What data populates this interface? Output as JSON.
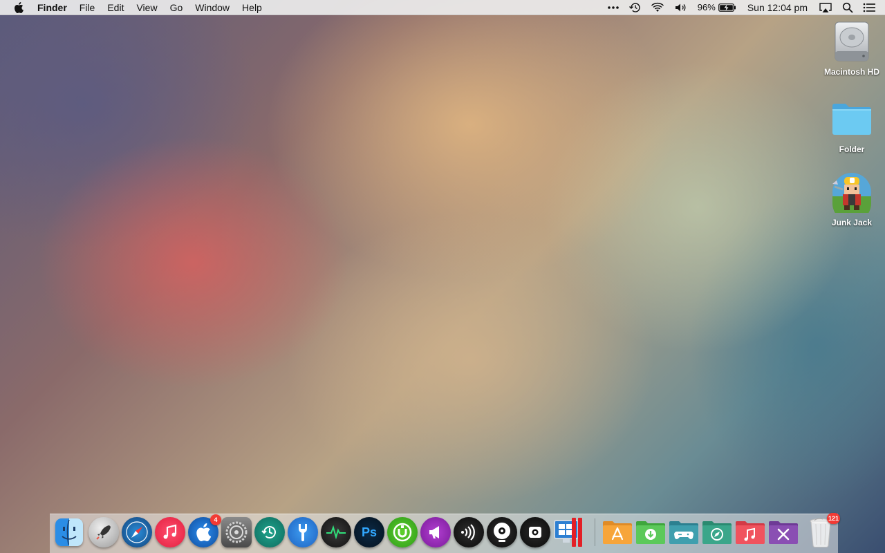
{
  "menubar": {
    "app_name": "Finder",
    "menus": [
      "File",
      "Edit",
      "View",
      "Go",
      "Window",
      "Help"
    ],
    "status": {
      "battery_percent": "96%",
      "clock": "Sun 12:04 pm"
    }
  },
  "desktop": {
    "icons": [
      {
        "label": "Macintosh HD"
      },
      {
        "label": "Folder"
      },
      {
        "label": "Junk Jack"
      }
    ]
  },
  "dock": {
    "apps": [
      {
        "name": "finder-icon"
      },
      {
        "name": "launchpad-icon"
      },
      {
        "name": "safari-icon"
      },
      {
        "name": "itunes-icon"
      },
      {
        "name": "app-store-icon",
        "badge": "4"
      },
      {
        "name": "system-preferences-icon"
      },
      {
        "name": "time-machine-icon"
      },
      {
        "name": "utility-tool-icon"
      },
      {
        "name": "activity-monitor-icon"
      },
      {
        "name": "photoshop-icon"
      },
      {
        "name": "utorrent-icon"
      },
      {
        "name": "megaphone-app-icon"
      },
      {
        "name": "audio-app-icon"
      },
      {
        "name": "disc-app-icon"
      },
      {
        "name": "screenshot-app-icon"
      },
      {
        "name": "parallels-windows-icon"
      }
    ],
    "folders": [
      {
        "name": "applications-folder-icon",
        "color": "#f7a53a"
      },
      {
        "name": "downloads-folder-icon",
        "color": "#5cc95a"
      },
      {
        "name": "games-folder-icon",
        "color": "#3f9fae"
      },
      {
        "name": "safari-folder-icon",
        "color": "#3aa68a"
      },
      {
        "name": "music-folder-icon",
        "color": "#f0535e"
      },
      {
        "name": "utilities-folder-icon",
        "color": "#8a4fb3"
      }
    ],
    "trash": {
      "badge": "121"
    },
    "labels": {
      "photoshop": "Ps"
    }
  }
}
